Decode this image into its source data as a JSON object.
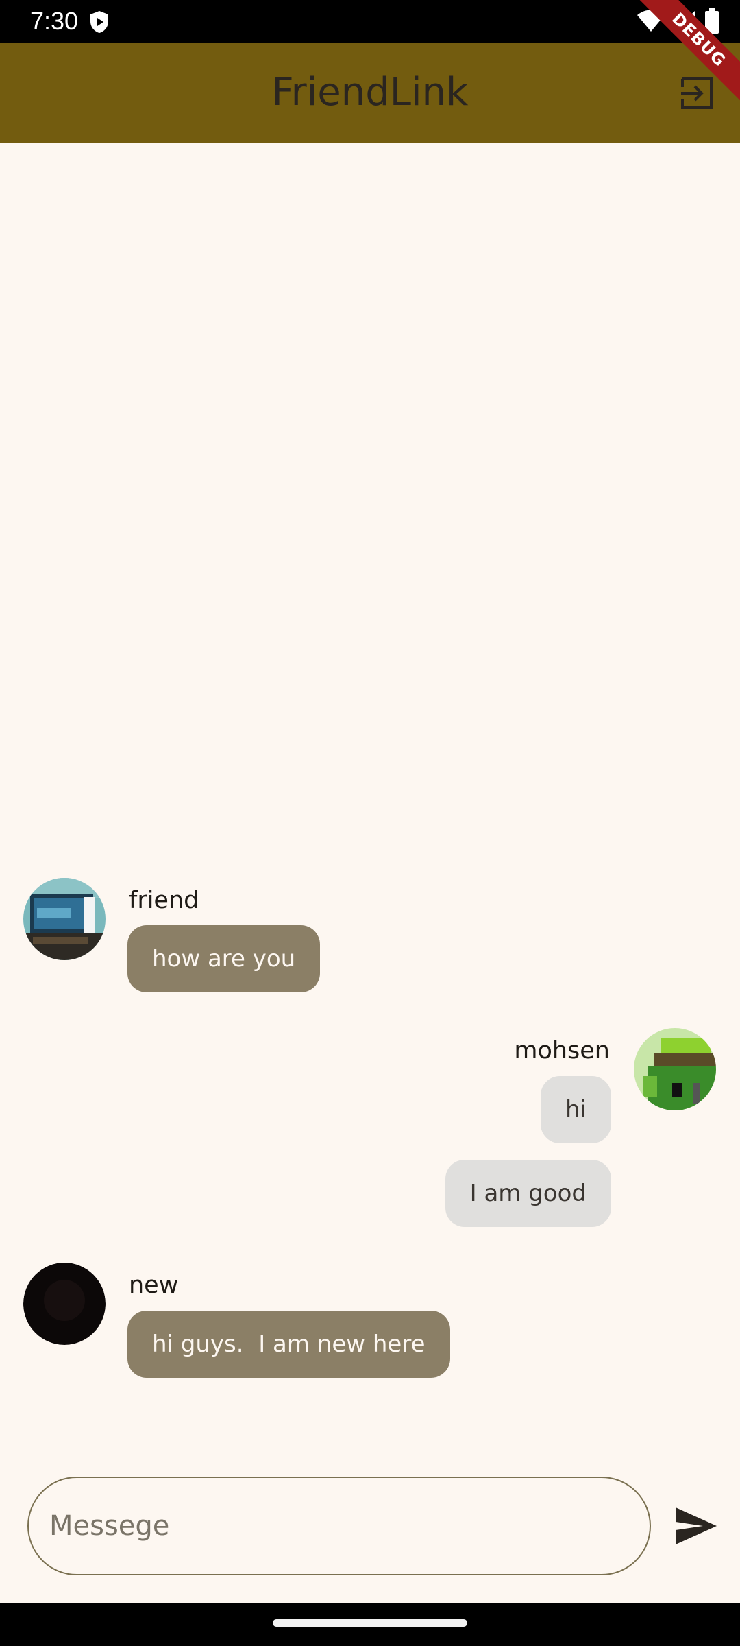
{
  "status_bar": {
    "time": "7:30"
  },
  "app_bar": {
    "title": "FriendLink",
    "logout_icon": "logout-icon",
    "color": "#735c0f"
  },
  "debug_banner": {
    "label": "DEBUG"
  },
  "messages": [
    {
      "sender": "friend",
      "text": "how are you",
      "direction": "received"
    },
    {
      "sender": "mohsen",
      "text": "hi",
      "direction": "sent"
    },
    {
      "sender": "mohsen",
      "text": "I am good",
      "direction": "sent"
    },
    {
      "sender": "new",
      "text": "hi guys.  I am new here",
      "direction": "received"
    }
  ],
  "input": {
    "placeholder": "Messege",
    "value": ""
  },
  "send_icon": "send-icon",
  "colors": {
    "background": "#fdf7f1",
    "received_bubble": "#8b7f66",
    "sent_bubble": "#e0dfdd"
  }
}
